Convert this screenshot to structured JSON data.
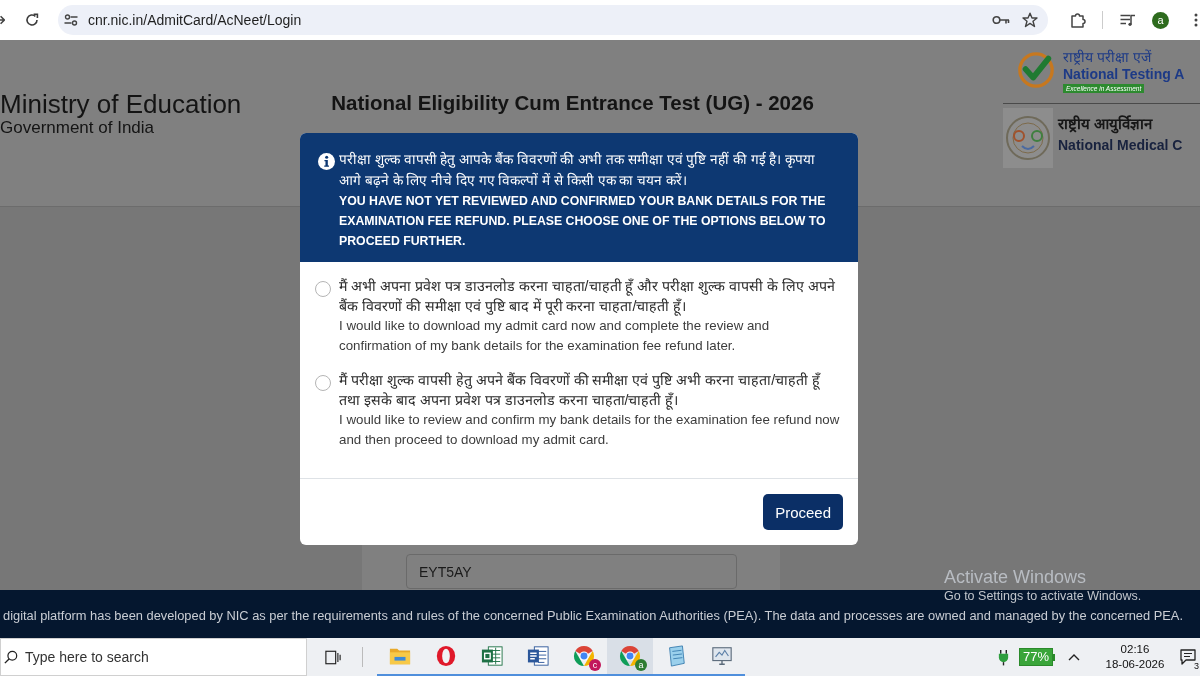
{
  "browser": {
    "url": "cnr.nic.in/AdmitCard/AcNeet/Login",
    "profile_initial": "a"
  },
  "header": {
    "ministry": "Ministry of Education",
    "government": "Government of India",
    "exam_title": "National Eligibility Cum Entrance Test (UG) - 2026",
    "logos": [
      {
        "kind": "nta",
        "hindi": "राष्ट्रीय परीक्षा एजें",
        "english": "National Testing A",
        "tagline": "Excellence in Assessment"
      },
      {
        "kind": "nmc",
        "hindi": "राष्ट्रीय आयुर्विज्ञान",
        "english": "National Medical C"
      }
    ]
  },
  "modal": {
    "message_hindi": "परीक्षा शुल्क वापसी हेतु आपके बैंक विवरणों की अभी तक समीक्षा एवं पुष्टि नहीं की गई है। कृपया आगे बढ़ने के लिए नीचे दिए गए विकल्पों में से किसी एक का चयन करें।",
    "message_english": "YOU HAVE NOT YET REVIEWED AND CONFIRMED YOUR BANK DETAILS FOR THE EXAMINATION FEE REFUND. PLEASE CHOOSE ONE OF THE OPTIONS BELOW TO PROCEED FURTHER.",
    "options": [
      {
        "hindi": "मैं अभी अपना प्रवेश पत्र डाउनलोड करना चाहता/चाहती हूँ और परीक्षा शुल्क वापसी के लिए अपने बैंक विवरणों की समीक्षा एवं पुष्टि बाद में पूरी करना चाहता/चाहती हूँ।",
        "english": "I would like to download my admit card now and complete the review and confirmation of my bank details for the examination fee refund later.",
        "selected": false
      },
      {
        "hindi": "मैं परीक्षा शुल्क वापसी हेतु अपने बैंक विवरणों की समीक्षा एवं पुष्टि अभी करना चाहता/चाहती हूँ तथा इसके बाद अपना प्रवेश पत्र डाउनलोड करना चाहता/चाहती हूँ।",
        "english": "I would like to review and confirm my bank details for the examination fee refund now and then proceed to download my admit card.",
        "selected": false
      }
    ],
    "button": "Proceed"
  },
  "form": {
    "code_value": "EYT5AY"
  },
  "activation_notice": {
    "title": "Activate Windows",
    "hint": "Go to Settings to activate Windows."
  },
  "footer": {
    "notice": "digital platform has been developed by NIC as per the requirements and rules of the concerned Public Examination Authorities (PEA). The data and processes are owned and managed by the concerned PEA."
  },
  "taskbar": {
    "search_placeholder": "Type here to search",
    "apps": [
      {
        "kind": "folder",
        "running": true,
        "selected": false
      },
      {
        "kind": "ring",
        "running": true,
        "selected": false
      },
      {
        "kind": "spreadsheet",
        "running": true,
        "selected": false
      },
      {
        "kind": "document",
        "running": true,
        "selected": false
      },
      {
        "kind": "browser",
        "running": true,
        "selected": false,
        "badge": "c",
        "color": "#c2185b"
      },
      {
        "kind": "browser",
        "running": true,
        "selected": true,
        "badge": "a",
        "color": "#2e7d32"
      },
      {
        "kind": "notepad",
        "running": true,
        "selected": false
      },
      {
        "kind": "monitor",
        "running": true,
        "selected": false
      }
    ],
    "battery": "77%",
    "time": "02:16",
    "date": "18-06-2026",
    "notifications": "3"
  }
}
